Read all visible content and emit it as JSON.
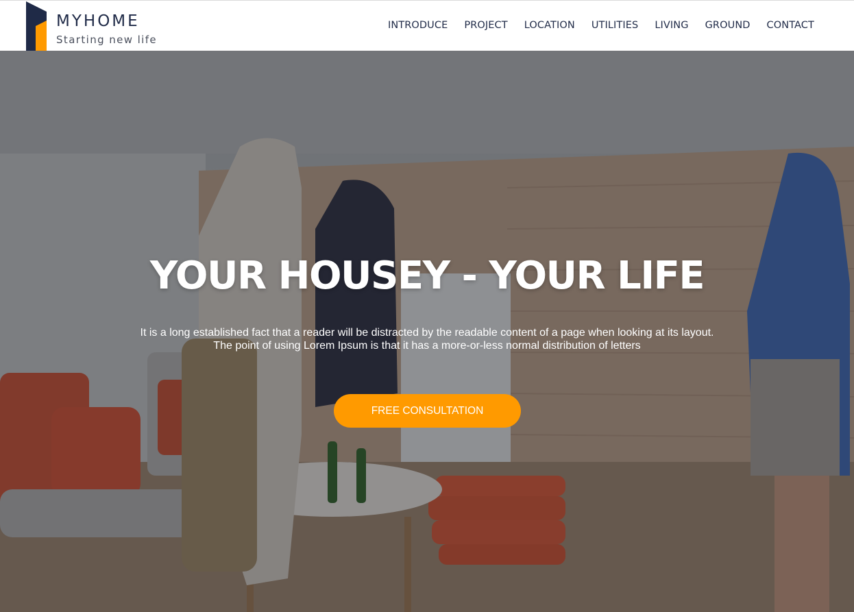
{
  "brand": {
    "name": "MYHOME",
    "tagline": "Starting new life",
    "colors": {
      "navy": "#1f2a47",
      "orange": "#ff9a00"
    }
  },
  "nav": {
    "items": [
      {
        "label": "INTRODUCE"
      },
      {
        "label": "PROJECT"
      },
      {
        "label": "LOCATION"
      },
      {
        "label": "UTILITIES"
      },
      {
        "label": "LIVING"
      },
      {
        "label": "GROUND"
      },
      {
        "label": "CONTACT"
      }
    ]
  },
  "hero": {
    "title": "YOUR HOUSEY - YOUR LIFE",
    "text_line1": "It is a long established fact that a reader will be distracted by the readable content of a page when looking at its layout.",
    "text_line2": "The point of using Lorem Ipsum is that it has a more-or-less normal distribution of letters",
    "cta_label": "FREE CONSULTATION",
    "cta_color": "#ff9a00"
  }
}
